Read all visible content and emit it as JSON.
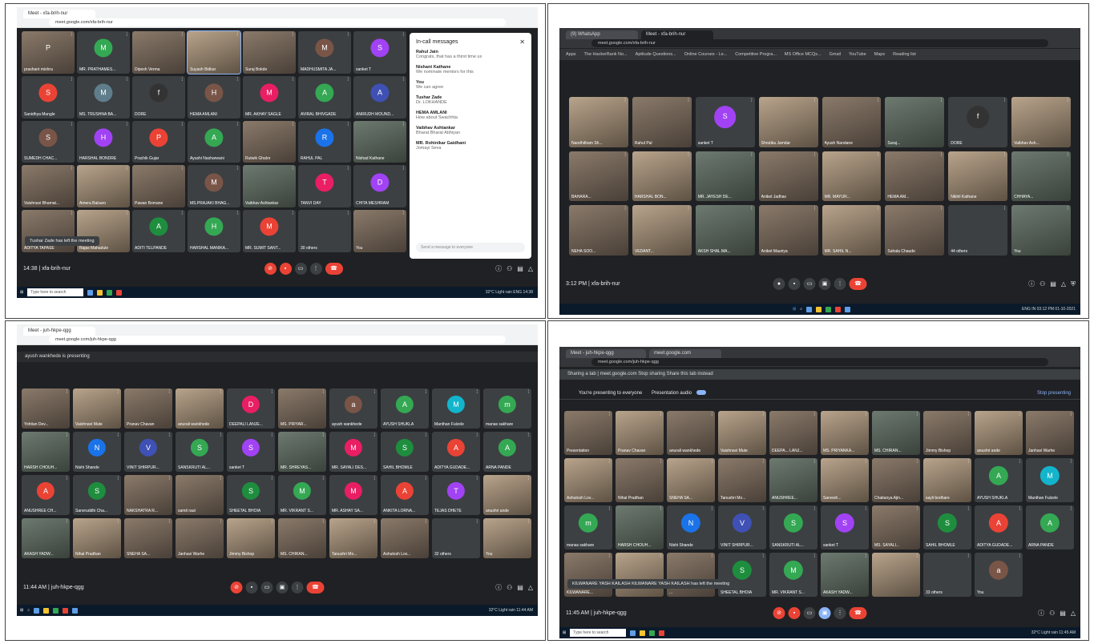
{
  "q1": {
    "tab": "Meet - xfa-brih-nur",
    "url": "meet.google.com/xfa-brih-nur",
    "meeting_info": "14:38 | xfa-brih-nur",
    "toast": "Tushar Zade has left the meeting",
    "others_tile": "30 others",
    "panel_title": "In-call messages",
    "panel_messages": [
      {
        "name": "Rahul Jain",
        "text": "Congrats, that has a thirst time us"
      },
      {
        "name": "Nishant Kathane",
        "text": "We nominate mentors for this"
      },
      {
        "name": "You",
        "text": "We can agree"
      },
      {
        "name": "Tushar Zade",
        "text": "Dr. LOKHANDE"
      },
      {
        "name": "HEMA AMLANI",
        "text": "How about Swachhta"
      },
      {
        "name": "Vaibhav Ashtankar",
        "text": "Bharat Bharat Abhiyan"
      },
      {
        "name": "MR. Rohinikar Gaidhani",
        "text": "Jomayi Seva"
      }
    ],
    "panel_input": "Send a message to everyone",
    "search_placeholder": "Type here to search",
    "tray": "32°C Light rain  ENG 14:38",
    "tiles": [
      {
        "name": "prashant mishra",
        "av": "P",
        "color": "",
        "cam": "cam"
      },
      {
        "name": "MR. PRATHAMES...",
        "av": "M",
        "color": "#34a853",
        "cam": ""
      },
      {
        "name": "Dipesh Verma",
        "av": "",
        "color": "",
        "cam": "cam"
      },
      {
        "name": "Suyash Bidkar",
        "av": "",
        "color": "",
        "cam": "cam2",
        "active": true
      },
      {
        "name": "Suraj Bokde",
        "av": "",
        "color": "",
        "cam": "cam"
      },
      {
        "name": "MADHUSMITA JA...",
        "av": "M",
        "color": "#795548",
        "cam": ""
      },
      {
        "name": "sanket T",
        "av": "S",
        "color": "#a142f4",
        "cam": ""
      },
      {
        "name": "Sanidhya Mungle",
        "av": "S",
        "color": "#ea4335",
        "cam": ""
      },
      {
        "name": "MS. TRUSHNA BA...",
        "av": "M",
        "color": "#607d8b",
        "cam": ""
      },
      {
        "name": "DORE",
        "av": "f",
        "color": "#333",
        "cam": ""
      },
      {
        "name": "HEMA AMLANI",
        "av": "H",
        "color": "#795548",
        "cam": ""
      },
      {
        "name": "MR. AKHAY SAGLE",
        "av": "M",
        "color": "#e91e63",
        "cam": ""
      },
      {
        "name": "AVIRAL BHIVGADE",
        "av": "A",
        "color": "#34a853",
        "cam": ""
      },
      {
        "name": "ANIRUDH MOUND...",
        "av": "A",
        "color": "#3f51b5",
        "cam": ""
      },
      {
        "name": "SUMEDH CHAC...",
        "av": "S",
        "color": "#795548",
        "cam": ""
      },
      {
        "name": "HARSHAL BONDRE",
        "av": "H",
        "color": "#a142f4",
        "cam": ""
      },
      {
        "name": "Prachik Gujar",
        "av": "P",
        "color": "#ea4335",
        "cam": ""
      },
      {
        "name": "Ayushi Nasharwani",
        "av": "A",
        "color": "#34a853",
        "cam": ""
      },
      {
        "name": "Rutwik Ghalor",
        "av": "",
        "color": "",
        "cam": "cam"
      },
      {
        "name": "RAHUL PAL",
        "av": "R",
        "color": "#1a73e8",
        "cam": ""
      },
      {
        "name": "Nishad Kathane",
        "av": "",
        "color": "",
        "cam": "cam3"
      },
      {
        "name": "Vaishnavi Bhamat...",
        "av": "",
        "color": "",
        "cam": "cam"
      },
      {
        "name": "Amera Balsaro",
        "av": "",
        "color": "",
        "cam": "cam2"
      },
      {
        "name": "Pawan Bomane",
        "av": "",
        "color": "",
        "cam": "cam"
      },
      {
        "name": "MS.PRAJAKI BHAG...",
        "av": "M",
        "color": "#795548",
        "cam": ""
      },
      {
        "name": "Vaibhav Ashtankar",
        "av": "",
        "color": "",
        "cam": "cam3"
      },
      {
        "name": "TANVI DAY",
        "av": "T",
        "color": "#e91e63",
        "cam": ""
      },
      {
        "name": "CHITA MESHRAM",
        "av": "D",
        "color": "#a142f4",
        "cam": ""
      },
      {
        "name": "ADITYA TAPASE",
        "av": "",
        "color": "",
        "cam": "cam"
      },
      {
        "name": "Rajas Mahadule",
        "av": "",
        "color": "",
        "cam": "cam2"
      },
      {
        "name": "ADITI TELPANDE",
        "av": "A",
        "color": "#1e8e3e",
        "cam": ""
      },
      {
        "name": "HARSHAL MANIKA...",
        "av": "H",
        "color": "#34a853",
        "cam": ""
      },
      {
        "name": "MR. SUMIT SANT...",
        "av": "M",
        "color": "#ea4335",
        "cam": ""
      },
      {
        "name": "30 others",
        "av": "",
        "color": "",
        "cam": ""
      },
      {
        "name": "You",
        "av": "",
        "color": "",
        "cam": "cam"
      }
    ]
  },
  "q2": {
    "tabs": [
      "(9) WhatsApp",
      "Meet - xfa-brih-nur"
    ],
    "url": "meet.google.com/xfa-brih-nur",
    "bookmarks": [
      "Apps",
      "The HackerBank No...",
      "Aptitude Questions...",
      "Online Courses - Le...",
      "Competitive Progra...",
      "MS Office MCQs...",
      "Gmail",
      "YouTube",
      "Maps",
      "Reading list"
    ],
    "meeting_info": "3:12 PM | xfa-brih-nur",
    "tray": "ENG IN  03:12 PM 01-10-2021",
    "tiles": [
      {
        "name": "Nandhitham Sh...",
        "av": "",
        "color": "",
        "cam": "cam2"
      },
      {
        "name": "Rahul Pal",
        "av": "",
        "color": "",
        "cam": "cam"
      },
      {
        "name": "sanket T",
        "av": "S",
        "color": "#a142f4",
        "cam": ""
      },
      {
        "name": "Shrutika Jamdar",
        "av": "",
        "color": "",
        "cam": "cam2"
      },
      {
        "name": "Ayush Nandane",
        "av": "",
        "color": "",
        "cam": "cam"
      },
      {
        "name": "Suraj...",
        "av": "",
        "color": "",
        "cam": "cam3"
      },
      {
        "name": "DORE",
        "av": "f",
        "color": "#333",
        "cam": ""
      },
      {
        "name": "Vaibhav Ash...",
        "av": "",
        "color": "",
        "cam": "cam2"
      },
      {
        "name": "BAHARA...",
        "av": "",
        "color": "",
        "cam": "cam"
      },
      {
        "name": "HARSHAL BON...",
        "av": "",
        "color": "",
        "cam": "cam2"
      },
      {
        "name": "MR. JAYESH DE...",
        "av": "",
        "color": "",
        "cam": "cam3"
      },
      {
        "name": "Aniket Jadhav",
        "av": "",
        "color": "",
        "cam": "cam"
      },
      {
        "name": "MR. MAYUR...",
        "av": "",
        "color": "",
        "cam": "cam2"
      },
      {
        "name": "HEMA AM...",
        "av": "",
        "color": "",
        "cam": "cam"
      },
      {
        "name": "Nikhil Kathane",
        "av": "",
        "color": "",
        "cam": "cam2"
      },
      {
        "name": "CHHAYA...",
        "av": "",
        "color": "",
        "cam": "cam3"
      },
      {
        "name": "NEHA SOO...",
        "av": "",
        "color": "",
        "cam": "cam"
      },
      {
        "name": "VEDANT...",
        "av": "",
        "color": "",
        "cam": "cam2"
      },
      {
        "name": "AKSH SHAL MA...",
        "av": "",
        "color": "",
        "cam": "cam3"
      },
      {
        "name": "Aniket Mauriya",
        "av": "",
        "color": "",
        "cam": "cam"
      },
      {
        "name": "MR. SAHIL N...",
        "av": "",
        "color": "",
        "cam": "cam2"
      },
      {
        "name": "Sahala Chaude",
        "av": "",
        "color": "",
        "cam": "cam"
      },
      {
        "name": "44 others",
        "av": "",
        "color": "",
        "cam": ""
      },
      {
        "name": "You",
        "av": "",
        "color": "",
        "cam": "cam3"
      }
    ]
  },
  "q3": {
    "tab": "Meet - juh-hkpe-qgg",
    "url": "meet.google.com/juh-hkpe-qgg",
    "banner": "ayush wankhede is presenting",
    "meeting_info": "11:44 AM | juh-hkpe-qgg",
    "tray": "32°C Light rain  11:44 AM",
    "tiles": [
      {
        "name": "Yohitan Dev...",
        "av": "",
        "color": "",
        "cam": "cam"
      },
      {
        "name": "Vaishnavi Mute",
        "av": "",
        "color": "",
        "cam": "cam2"
      },
      {
        "name": "Pranav Chavan",
        "av": "",
        "color": "",
        "cam": "cam"
      },
      {
        "name": "anurali wankhede",
        "av": "",
        "color": "",
        "cam": "cam2"
      },
      {
        "name": "DEEPALI LANJE...",
        "av": "D",
        "color": "#e91e63",
        "cam": ""
      },
      {
        "name": "MS. PRIYAR...",
        "av": "",
        "color": "",
        "cam": "cam"
      },
      {
        "name": "ayush wankhede",
        "av": "a",
        "color": "#795548",
        "cam": ""
      },
      {
        "name": "AYUSH SHUKLA",
        "av": "A",
        "color": "#34a853",
        "cam": ""
      },
      {
        "name": "Manthan Fulzele",
        "av": "M",
        "color": "#12b5cb",
        "cam": ""
      },
      {
        "name": "manas sakhare",
        "av": "m",
        "color": "#34a853",
        "cam": ""
      },
      {
        "name": "HARSH CHOUH...",
        "av": "",
        "color": "",
        "cam": "cam3"
      },
      {
        "name": "Nishi Shande",
        "av": "N",
        "color": "#1a73e8",
        "cam": ""
      },
      {
        "name": "VINIT SHIRPUR...",
        "av": "V",
        "color": "#3f51b5",
        "cam": ""
      },
      {
        "name": "SANSKRUTI AL...",
        "av": "S",
        "color": "#34a853",
        "cam": ""
      },
      {
        "name": "sanket T",
        "av": "S",
        "color": "#a142f4",
        "cam": ""
      },
      {
        "name": "MR. SHREYAS...",
        "av": "",
        "color": "",
        "cam": "cam3"
      },
      {
        "name": "MR. SAYALI DES...",
        "av": "M",
        "color": "#e91e63",
        "cam": ""
      },
      {
        "name": "SAHIL BHOMLE",
        "av": "S",
        "color": "#1e8e3e",
        "cam": ""
      },
      {
        "name": "ADITYA GUDADE...",
        "av": "A",
        "color": "#ea4335",
        "cam": ""
      },
      {
        "name": "ARNA PANDE",
        "av": "A",
        "color": "#34a853",
        "cam": ""
      },
      {
        "name": "ANUSHREE CH...",
        "av": "A",
        "color": "#ea4335",
        "cam": ""
      },
      {
        "name": "Sanvruddhi Cha...",
        "av": "S",
        "color": "#1e8e3e",
        "cam": ""
      },
      {
        "name": "NAKSHATRA R...",
        "av": "",
        "color": "",
        "cam": "cam"
      },
      {
        "name": "samit raut",
        "av": "",
        "color": "",
        "cam": "cam"
      },
      {
        "name": "SHEETAL BHOIA",
        "av": "S",
        "color": "#1e8e3e",
        "cam": ""
      },
      {
        "name": "MR. VIKRANT S...",
        "av": "M",
        "color": "#34a853",
        "cam": ""
      },
      {
        "name": "MR. ASHAY SA...",
        "av": "M",
        "color": "#e91e63",
        "cam": ""
      },
      {
        "name": "ANKITA LORNA...",
        "av": "A",
        "color": "#ea4335",
        "cam": ""
      },
      {
        "name": "TEJAS DHETE",
        "av": "T",
        "color": "#a142f4",
        "cam": ""
      },
      {
        "name": "anushri ande",
        "av": "",
        "color": "",
        "cam": "cam2"
      },
      {
        "name": "AKASH YADW...",
        "av": "",
        "color": "",
        "cam": "cam3"
      },
      {
        "name": "Nihal Pradhan",
        "av": "",
        "color": "",
        "cam": "cam2"
      },
      {
        "name": "SNEHA SA...",
        "av": "",
        "color": "",
        "cam": "cam"
      },
      {
        "name": "Janhavi Warhe",
        "av": "",
        "color": "",
        "cam": "cam"
      },
      {
        "name": "Jimmy Bishop",
        "av": "",
        "color": "",
        "cam": "cam2"
      },
      {
        "name": "MS. CHIRAN...",
        "av": "",
        "color": "",
        "cam": "cam"
      },
      {
        "name": "Tanushri Mo...",
        "av": "",
        "color": "",
        "cam": "cam2"
      },
      {
        "name": "Ashutosh Lov...",
        "av": "",
        "color": "",
        "cam": "cam"
      },
      {
        "name": "32 others",
        "av": "",
        "color": "",
        "cam": ""
      },
      {
        "name": "You",
        "av": "",
        "color": "",
        "cam": "cam2"
      }
    ]
  },
  "q4": {
    "tabs": [
      "Meet - juh-hkpe-qgg",
      "meet.google.com"
    ],
    "url": "meet.google.com/juh-hkpe-qgg",
    "info_bar": "Sharing a tab | meet.google.com  Stop sharing  Share this tab instead",
    "presenting": "You're presenting to everyone",
    "presentation_audio": "Presentation audio",
    "stop": "Stop presenting",
    "toast": "KILWANARE YASH KAILASH KILWANARE YASH KAILASH has left the meeting",
    "meeting_info": "11:45 AM | juh-hkpe-qgg",
    "search_placeholder": "Type here to search",
    "tray": "32°C Light rain  11:45 AM",
    "tiles": [
      {
        "name": "Presentation",
        "av": "",
        "color": "",
        "cam": "cam"
      },
      {
        "name": "Pranav Chavan",
        "av": "",
        "color": "",
        "cam": "cam2"
      },
      {
        "name": "anurali wankhede",
        "av": "",
        "color": "",
        "cam": "cam"
      },
      {
        "name": "Vaishnavi Mute",
        "av": "",
        "color": "",
        "cam": "cam2"
      },
      {
        "name": "DEEPA... LANJ...",
        "av": "",
        "color": "",
        "cam": "cam"
      },
      {
        "name": "MS. PRIYANKA...",
        "av": "",
        "color": "",
        "cam": "cam2"
      },
      {
        "name": "MS. CHIRAN...",
        "av": "",
        "color": "",
        "cam": "cam3"
      },
      {
        "name": "Jimmy Bishop",
        "av": "",
        "color": "",
        "cam": "cam"
      },
      {
        "name": "anushri ande",
        "av": "",
        "color": "",
        "cam": "cam2"
      },
      {
        "name": "Janhavi Warhe",
        "av": "",
        "color": "",
        "cam": "cam"
      },
      {
        "name": "Ashutosh Lov...",
        "av": "",
        "color": "",
        "cam": "cam2"
      },
      {
        "name": "Nihal Pradhan",
        "av": "",
        "color": "",
        "cam": "cam"
      },
      {
        "name": "SNEHA SA...",
        "av": "",
        "color": "",
        "cam": "cam2"
      },
      {
        "name": "Tanushri Mo...",
        "av": "",
        "color": "",
        "cam": "cam"
      },
      {
        "name": "ANUSHREE...",
        "av": "",
        "color": "",
        "cam": "cam3"
      },
      {
        "name": "Sarvesh...",
        "av": "",
        "color": "",
        "cam": "cam2"
      },
      {
        "name": "Chaitanya Ajin...",
        "av": "",
        "color": "",
        "cam": "cam"
      },
      {
        "name": "sayli bodhare",
        "av": "",
        "color": "",
        "cam": "cam2"
      },
      {
        "name": "AYUSH SHUKLA",
        "av": "A",
        "color": "#34a853",
        "cam": ""
      },
      {
        "name": "Manthan Fulzele",
        "av": "M",
        "color": "#12b5cb",
        "cam": ""
      },
      {
        "name": "manas sakhare",
        "av": "m",
        "color": "#34a853",
        "cam": ""
      },
      {
        "name": "HARSH CHOUH...",
        "av": "",
        "color": "",
        "cam": "cam3"
      },
      {
        "name": "Nishi Shande",
        "av": "N",
        "color": "#1a73e8",
        "cam": ""
      },
      {
        "name": "VINIT SHIRPUR...",
        "av": "V",
        "color": "#3f51b5",
        "cam": ""
      },
      {
        "name": "SANSKRUTI AL...",
        "av": "S",
        "color": "#34a853",
        "cam": ""
      },
      {
        "name": "sanket T",
        "av": "S",
        "color": "#a142f4",
        "cam": ""
      },
      {
        "name": "MS. SAYALI...",
        "av": "",
        "color": "",
        "cam": "cam"
      },
      {
        "name": "SAHIL BHOMLE",
        "av": "S",
        "color": "#1e8e3e",
        "cam": ""
      },
      {
        "name": "ADITYA GUDADE...",
        "av": "A",
        "color": "#ea4335",
        "cam": ""
      },
      {
        "name": "ARNA PANDE",
        "av": "A",
        "color": "#34a853",
        "cam": ""
      },
      {
        "name": "KILWANARE...",
        "av": "",
        "color": "",
        "cam": "cam"
      },
      {
        "name": "",
        "av": "",
        "color": "",
        "cam": "cam2"
      },
      {
        "name": "...",
        "av": "",
        "color": "",
        "cam": "cam"
      },
      {
        "name": "SHEETAL BHOIA",
        "av": "S",
        "color": "#1e8e3e",
        "cam": ""
      },
      {
        "name": "MR. VIKRANT S...",
        "av": "M",
        "color": "#34a853",
        "cam": ""
      },
      {
        "name": "AKASH YADW...",
        "av": "",
        "color": "",
        "cam": "cam3"
      },
      {
        "name": "",
        "av": "",
        "color": "",
        "cam": "cam2"
      },
      {
        "name": "33 others",
        "av": "",
        "color": "",
        "cam": ""
      },
      {
        "name": "You",
        "av": "a",
        "color": "#795548",
        "cam": ""
      }
    ]
  }
}
